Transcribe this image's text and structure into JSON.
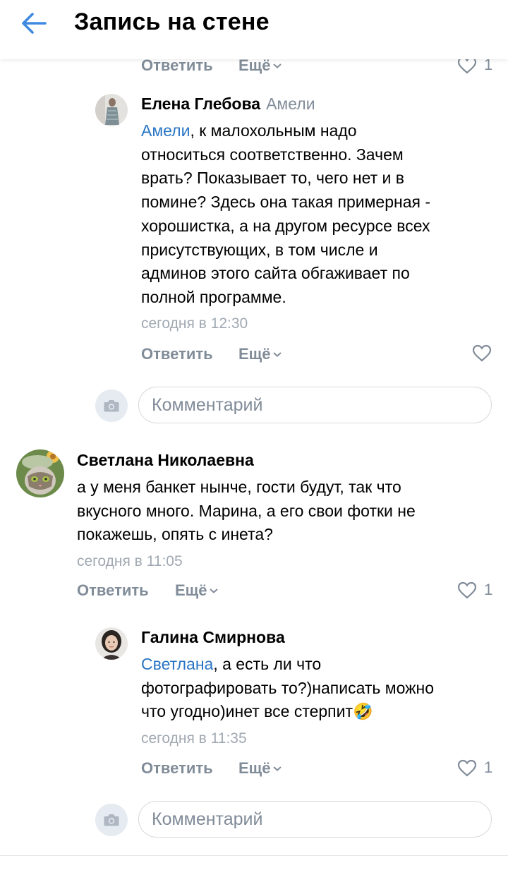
{
  "header": {
    "title": "Запись на стене"
  },
  "top_actions": {
    "reply": "Ответить",
    "more": "Ещё",
    "likes": "1"
  },
  "comments": [
    {
      "author": "Елена Глебова",
      "reply_to": "Амели",
      "mention": "Амели",
      "text_lines": [
        ", к малохольным надо",
        "относиться соответственно. Зачем",
        "врать? Показывает то, чего нет и в",
        "помине? Здесь она такая примерная -",
        "хорошистка, а на другом ресурсе всех",
        "присутствующих, в том числе и",
        "админов этого сайта обгаживает по",
        "полной программе."
      ],
      "time": "сегодня в 12:30",
      "reply": "Ответить",
      "more": "Ещё"
    },
    {
      "author": "Светлана Николаевна",
      "text_lines": [
        "а у меня банкет нынче, гости будут, так что",
        "вкусного много. Марина, а его свои фотки не",
        "покажешь, опять с инета?"
      ],
      "time": "сегодня в 11:05",
      "reply": "Ответить",
      "more": "Ещё",
      "likes": "1"
    },
    {
      "author": "Галина Смирнова",
      "mention": "Светлана",
      "text_lines": [
        ", а есть ли что",
        "фотографировать то?)написать можно",
        "что угодно)инет все стерпит"
      ],
      "emoji": "🤣",
      "time": "сегодня в 11:35",
      "reply": "Ответить",
      "more": "Ещё",
      "likes": "1"
    }
  ],
  "comment_box": {
    "placeholder": "Комментарий"
  },
  "colors": {
    "accent": "#2a75c4",
    "secondary_text": "#818c99",
    "timestamp": "#a0a8b2"
  }
}
